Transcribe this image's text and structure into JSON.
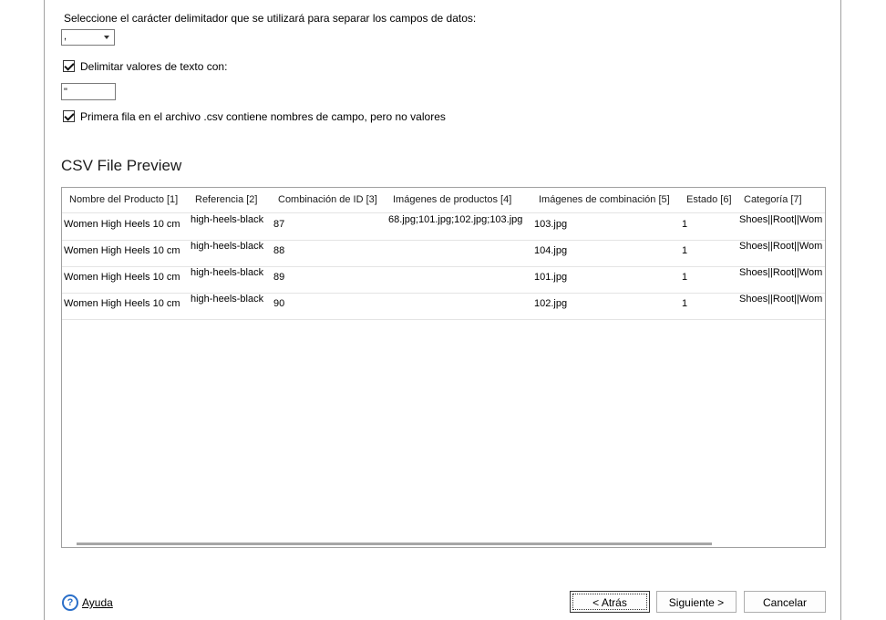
{
  "delimiter": {
    "label": "Seleccione el carácter delimitador que se utilizará para separar los campos de datos:",
    "selected": ","
  },
  "text_qualifier": {
    "checkbox_label": "Delimitar valores de texto con:",
    "checked": true,
    "value": "\""
  },
  "first_row": {
    "checkbox_label": "Primera fila en el archivo .csv contiene nombres de campo, pero no valores",
    "checked": true
  },
  "preview": {
    "title": "CSV File Preview",
    "columns": [
      "Nombre del Producto [1]",
      "Referencia [2]",
      "Combinación de ID [3]",
      "Imágenes de productos [4]",
      "Imágenes de combinación [5]",
      "Estado [6]",
      "Categoría [7]"
    ],
    "rows": [
      [
        "Women High Heels 10 cm",
        "high-heels-black",
        "87",
        "68.jpg;101.jpg;102.jpg;103.jpg",
        "103.jpg",
        "1",
        "Shoes||Root||Wom"
      ],
      [
        "Women High Heels 10 cm",
        "high-heels-black",
        "88",
        "",
        "104.jpg",
        "1",
        "Shoes||Root||Wom"
      ],
      [
        "Women High Heels 10 cm",
        "high-heels-black",
        "89",
        "",
        "101.jpg",
        "1",
        "Shoes||Root||Wom"
      ],
      [
        "Women High Heels 10 cm",
        "high-heels-black",
        "90",
        "",
        "102.jpg",
        "1",
        "Shoes||Root||Wom"
      ]
    ]
  },
  "footer": {
    "help_label": "Ayuda",
    "back_label": "< Atrás",
    "next_label": "Siguiente >",
    "cancel_label": "Cancelar"
  },
  "colors": {
    "help_icon": "#2a6fc9",
    "grid_border": "#a0a0a0"
  }
}
